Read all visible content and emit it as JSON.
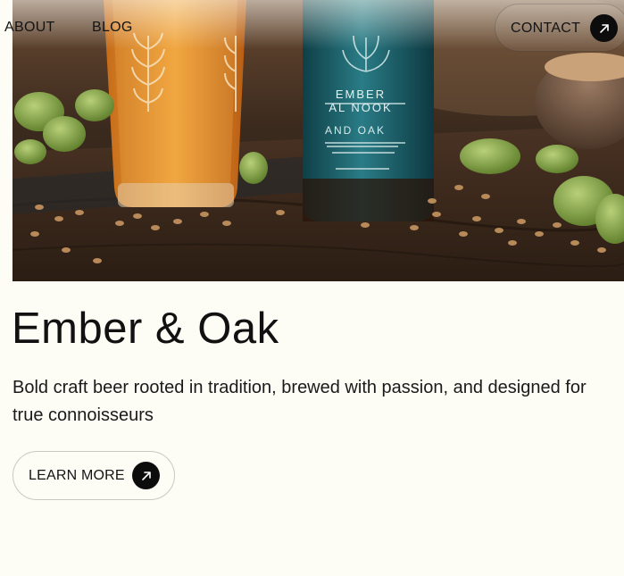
{
  "nav": {
    "about_label": "ABOUT",
    "blog_label": "BLOG",
    "contact_label": "CONTACT"
  },
  "hero_image": {
    "bottle_label_line1": "EMBER",
    "bottle_label_line2": "AL NOOK",
    "bottle_label_line3": "AND OAK"
  },
  "main": {
    "title": "Ember & Oak",
    "subtitle": "Bold craft beer rooted in tradition, brewed with passion, and designed for true connoisseurs",
    "cta_label": "LEARN MORE"
  },
  "colors": {
    "background": "#fdfcf5",
    "button_dark": "#0c0c0c",
    "bottle_teal": "#1f6a74",
    "beer_amber": "#d98a2a"
  },
  "icons": {
    "contact_arrow": "arrow-up-right-icon",
    "cta_arrow": "arrow-up-right-icon"
  }
}
